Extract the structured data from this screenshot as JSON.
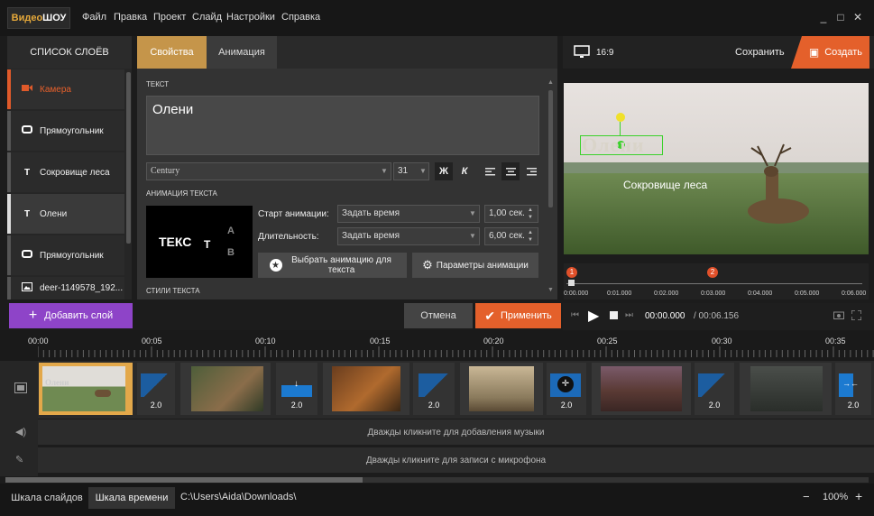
{
  "app": {
    "logo_part1": "Видео",
    "logo_part2": "ШОУ"
  },
  "menu": [
    "Файл",
    "Правка",
    "Проект",
    "Слайд",
    "Настройки",
    "Справка"
  ],
  "window": {
    "minimize": "_",
    "maximize": "□",
    "close": "✕"
  },
  "layers": {
    "title": "СПИСОК СЛОЁВ",
    "items": [
      {
        "label": "Камера",
        "icon": "camera-icon"
      },
      {
        "label": "Прямоугольник",
        "icon": "rectangle-icon"
      },
      {
        "label": "Сокровище леса",
        "icon": "text-icon"
      },
      {
        "label": "Олени",
        "icon": "text-icon"
      },
      {
        "label": "Прямоугольник",
        "icon": "rectangle-icon"
      },
      {
        "label": "deer-1149578_192...",
        "icon": "image-icon"
      }
    ],
    "add_label": "Добавить слой"
  },
  "tabs": {
    "properties": "Свойства",
    "animation": "Анимация"
  },
  "props": {
    "text_section": "ТЕКСТ",
    "text_value": "Олени",
    "font": "Century",
    "size": "31",
    "bold": "Ж",
    "italic": "К",
    "anim_section": "АНИМАЦИЯ ТЕКСТА",
    "preview_text": "ТЕКС",
    "preview_letters": [
      "Т",
      "А",
      "В"
    ],
    "start_label": "Старт анимации:",
    "start_value": "Задать время",
    "start_time": "1,00 сек.",
    "duration_label": "Длительность:",
    "duration_value": "Задать время",
    "duration_time": "6,00 сек.",
    "choose_anim": "Выбрать анимацию для текста",
    "anim_params": "Параметры анимации",
    "styles_section": "СТИЛИ ТЕКСТА"
  },
  "actions": {
    "cancel": "Отмена",
    "apply": "Применить"
  },
  "preview": {
    "ratio": "16:9",
    "save": "Сохранить",
    "create": "Создать",
    "title_text": "Олени",
    "subtitle_text": "Сокровище леса",
    "markers": [
      "1",
      "2"
    ],
    "ticks": [
      "0:00.000",
      "0:01.000",
      "0:02.000",
      "0:03.000",
      "0:04.000",
      "0:05.000",
      "0:06.000"
    ],
    "time_current": "00:00.000",
    "time_total": "/ 00:06.156"
  },
  "timeline": {
    "ticks": [
      "00:00",
      "00:05",
      "00:10",
      "00:15",
      "00:20",
      "00:25",
      "00:30",
      "00:35"
    ],
    "transitions": [
      "2.0",
      "2.0",
      "2.0",
      "2.0",
      "2.0",
      "2.0"
    ],
    "clip1_caption": "Олени",
    "music_hint": "Дважды кликните для добавления музыки",
    "mic_hint": "Дважды кликните для записи с микрофона"
  },
  "status": {
    "tab_slides": "Шкала слайдов",
    "tab_timeline": "Шкала времени",
    "path": "C:\\Users\\Aida\\Downloads\\",
    "zoom": "100%",
    "minus": "−",
    "plus": "+"
  }
}
